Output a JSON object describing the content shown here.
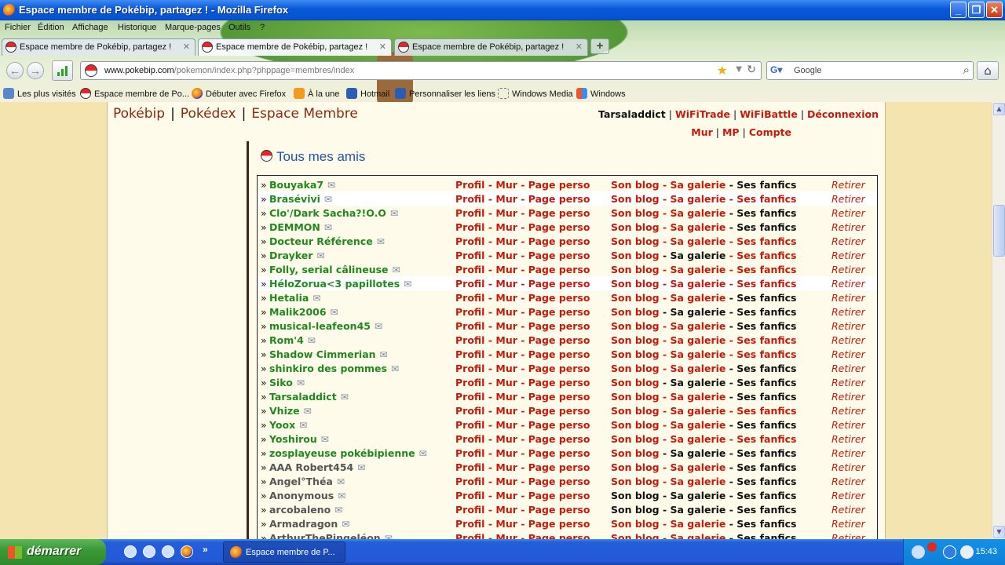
{
  "window": {
    "title": "Espace membre de Pokébip, partagez ! - Mozilla Firefox",
    "min": "_",
    "max": "❐",
    "close": "✕"
  },
  "menu": [
    "Fichier",
    "Édition",
    "Affichage",
    "Historique",
    "Marque-pages",
    "Outils",
    "?"
  ],
  "tabs": [
    {
      "label": "Espace membre de Pokébip, partagez !"
    },
    {
      "label": "Espace membre de Pokébip, partagez !"
    },
    {
      "label": "Espace membre de Pokébip, partagez !"
    }
  ],
  "newtab": "+",
  "nav": {
    "url_host": "www.pokebip.com",
    "url_path": "/pokemon/index.php?phppage=membres/index",
    "search_placeholder": "Google"
  },
  "bookmarks": [
    "Les plus visités",
    "Espace membre de Po...",
    "Débuter avec Firefox",
    "À la une",
    "Hotmail",
    "Personnaliser les liens",
    "Windows Media",
    "Windows"
  ],
  "site": {
    "nav": [
      "Pokébip",
      "Pokédex",
      "Espace Membre"
    ],
    "separator": "|",
    "user": "Tarsaladdict",
    "user_links": [
      "WiFiTrade",
      "WiFiBattle",
      "Déconnexion"
    ],
    "user_links2": [
      "Mur",
      "MP",
      "Compte"
    ]
  },
  "friends": {
    "heading": "Tous mes amis",
    "arrow": "»",
    "link_labels": [
      "Profil",
      "Mur",
      "Page perso"
    ],
    "blog_labels": [
      "Son blog",
      "Sa galerie",
      "Ses fanfics"
    ],
    "dash": " - ",
    "remove_label": "Retirer",
    "colors": {
      "online": "#1e8a1e",
      "offline": "#555555",
      "link": "#c61a0c",
      "inactive": "#111111"
    },
    "rows": [
      {
        "name": "Bouyaka7",
        "online": true,
        "blog": true,
        "gal": true,
        "fan": false,
        "hl": false
      },
      {
        "name": "Brasévivi",
        "online": true,
        "blog": true,
        "gal": true,
        "fan": true,
        "hl": true
      },
      {
        "name": "Clo'/Dark Sacha?!O.O",
        "online": true,
        "blog": true,
        "gal": true,
        "fan": false,
        "hl": false
      },
      {
        "name": "DEMMON",
        "online": true,
        "blog": true,
        "gal": true,
        "fan": false,
        "hl": false
      },
      {
        "name": "Docteur Référence",
        "online": true,
        "blog": true,
        "gal": true,
        "fan": true,
        "hl": false
      },
      {
        "name": "Drayker",
        "online": true,
        "blog": true,
        "gal": false,
        "fan": true,
        "hl": false
      },
      {
        "name": "Folly, serial câlineuse",
        "online": true,
        "blog": true,
        "gal": true,
        "fan": true,
        "hl": false
      },
      {
        "name": "HéloZorua<3 papillotes",
        "online": true,
        "blog": true,
        "gal": true,
        "fan": true,
        "hl": true
      },
      {
        "name": "Hetalia",
        "online": true,
        "blog": true,
        "gal": true,
        "fan": false,
        "hl": false
      },
      {
        "name": "Malik2006",
        "online": true,
        "blog": true,
        "gal": false,
        "fan": false,
        "hl": false
      },
      {
        "name": "musical-leafeon45",
        "online": true,
        "blog": true,
        "gal": true,
        "fan": false,
        "hl": false
      },
      {
        "name": "Rom'4",
        "online": true,
        "blog": true,
        "gal": true,
        "fan": true,
        "hl": false
      },
      {
        "name": "Shadow Cimmerian",
        "online": true,
        "blog": true,
        "gal": true,
        "fan": true,
        "hl": false
      },
      {
        "name": "shinkiro des pommes",
        "online": true,
        "blog": true,
        "gal": true,
        "fan": false,
        "hl": false
      },
      {
        "name": "Siko",
        "online": true,
        "blog": true,
        "gal": false,
        "fan": false,
        "hl": false
      },
      {
        "name": "Tarsaladdict",
        "online": true,
        "blog": true,
        "gal": true,
        "fan": false,
        "hl": false
      },
      {
        "name": "Vhize",
        "online": true,
        "blog": true,
        "gal": true,
        "fan": true,
        "hl": false
      },
      {
        "name": "Yoox",
        "online": true,
        "blog": true,
        "gal": true,
        "fan": false,
        "hl": false
      },
      {
        "name": "Yoshirou",
        "online": true,
        "blog": true,
        "gal": true,
        "fan": true,
        "hl": false
      },
      {
        "name": "zosplayeuse pokébipienne",
        "online": true,
        "blog": true,
        "gal": false,
        "fan": false,
        "hl": false
      },
      {
        "name": "AAA Robert454",
        "online": false,
        "blog": true,
        "gal": true,
        "fan": false,
        "hl": false
      },
      {
        "name": "Angel°Théa",
        "online": false,
        "blog": true,
        "gal": true,
        "fan": false,
        "hl": false
      },
      {
        "name": "Anonymous",
        "online": false,
        "blog": false,
        "gal": false,
        "fan": false,
        "hl": false
      },
      {
        "name": "arcobaleno",
        "online": false,
        "blog": false,
        "gal": false,
        "fan": false,
        "hl": false
      },
      {
        "name": "Armadragon",
        "online": false,
        "blog": true,
        "gal": true,
        "fan": false,
        "hl": false
      },
      {
        "name": "ArthurThePingeléon",
        "online": false,
        "blog": true,
        "gal": true,
        "fan": false,
        "hl": false
      }
    ]
  },
  "taskbar": {
    "start": "démarrer",
    "item": "Espace membre de P...",
    "clock": "15:43",
    "more": "»"
  }
}
